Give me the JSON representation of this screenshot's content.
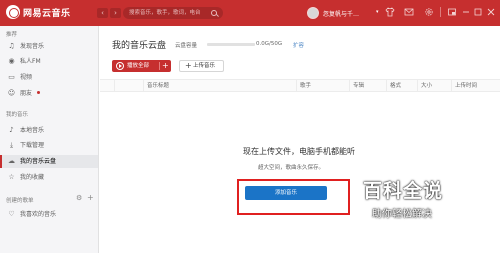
{
  "app": {
    "name": "网易云音乐",
    "search_placeholder": "搜索音乐，歌手，歌词，电台",
    "nav": {
      "back": "‹",
      "forward": "›"
    },
    "user": {
      "name": "忽复帆与千…",
      "caret": "▾"
    },
    "titlebar_icons": [
      "shirt-icon",
      "mail-icon",
      "settings-icon",
      "separator",
      "minimize-icon",
      "restore-icon",
      "close-icon"
    ]
  },
  "sidebar": {
    "recommend_title": "推荐",
    "recommend_items": [
      {
        "label": "发现音乐",
        "icon": "♫"
      },
      {
        "label": "私人FM",
        "icon": "◉"
      },
      {
        "label": "视频",
        "icon": "▭"
      },
      {
        "label": "朋友",
        "icon": "☺"
      }
    ],
    "my_music_title": "我的音乐",
    "my_music_items": [
      {
        "label": "本地音乐",
        "icon": "♪"
      },
      {
        "label": "下载管理",
        "icon": "⤓"
      },
      {
        "label": "我的音乐云盘",
        "icon": "☁"
      },
      {
        "label": "我的收藏",
        "icon": "☆"
      }
    ],
    "playlists_title": "创建的歌单",
    "playlist_actions": {
      "settings": "⚙",
      "add": "+"
    },
    "playlists": [
      {
        "label": "我喜欢的音乐",
        "icon": "♡"
      }
    ]
  },
  "main": {
    "title": "我的音乐云盘",
    "capacity": {
      "label": "云盘容量",
      "used_fraction": 0.0,
      "text": "0.0G/50G",
      "expand": "扩容"
    },
    "play_all": "播放全部",
    "play_all_plus": "+",
    "upload": "上传音乐",
    "upload_plus": "+",
    "columns": [
      "音乐标题",
      "歌手",
      "专辑",
      "格式",
      "大小",
      "上传时间"
    ],
    "empty_title": "现在上传文件，电脑手机都能听",
    "empty_sub": "超大空间，歌曲永久保存。",
    "add_music": "添加音乐"
  },
  "watermark": {
    "title": "百科全说",
    "subtitle": "助你轻松解决"
  },
  "colors": {
    "brand": "#c62f2f",
    "link": "#4b85c4",
    "primary_button": "#1b74c7",
    "highlight_box": "#e02020"
  }
}
